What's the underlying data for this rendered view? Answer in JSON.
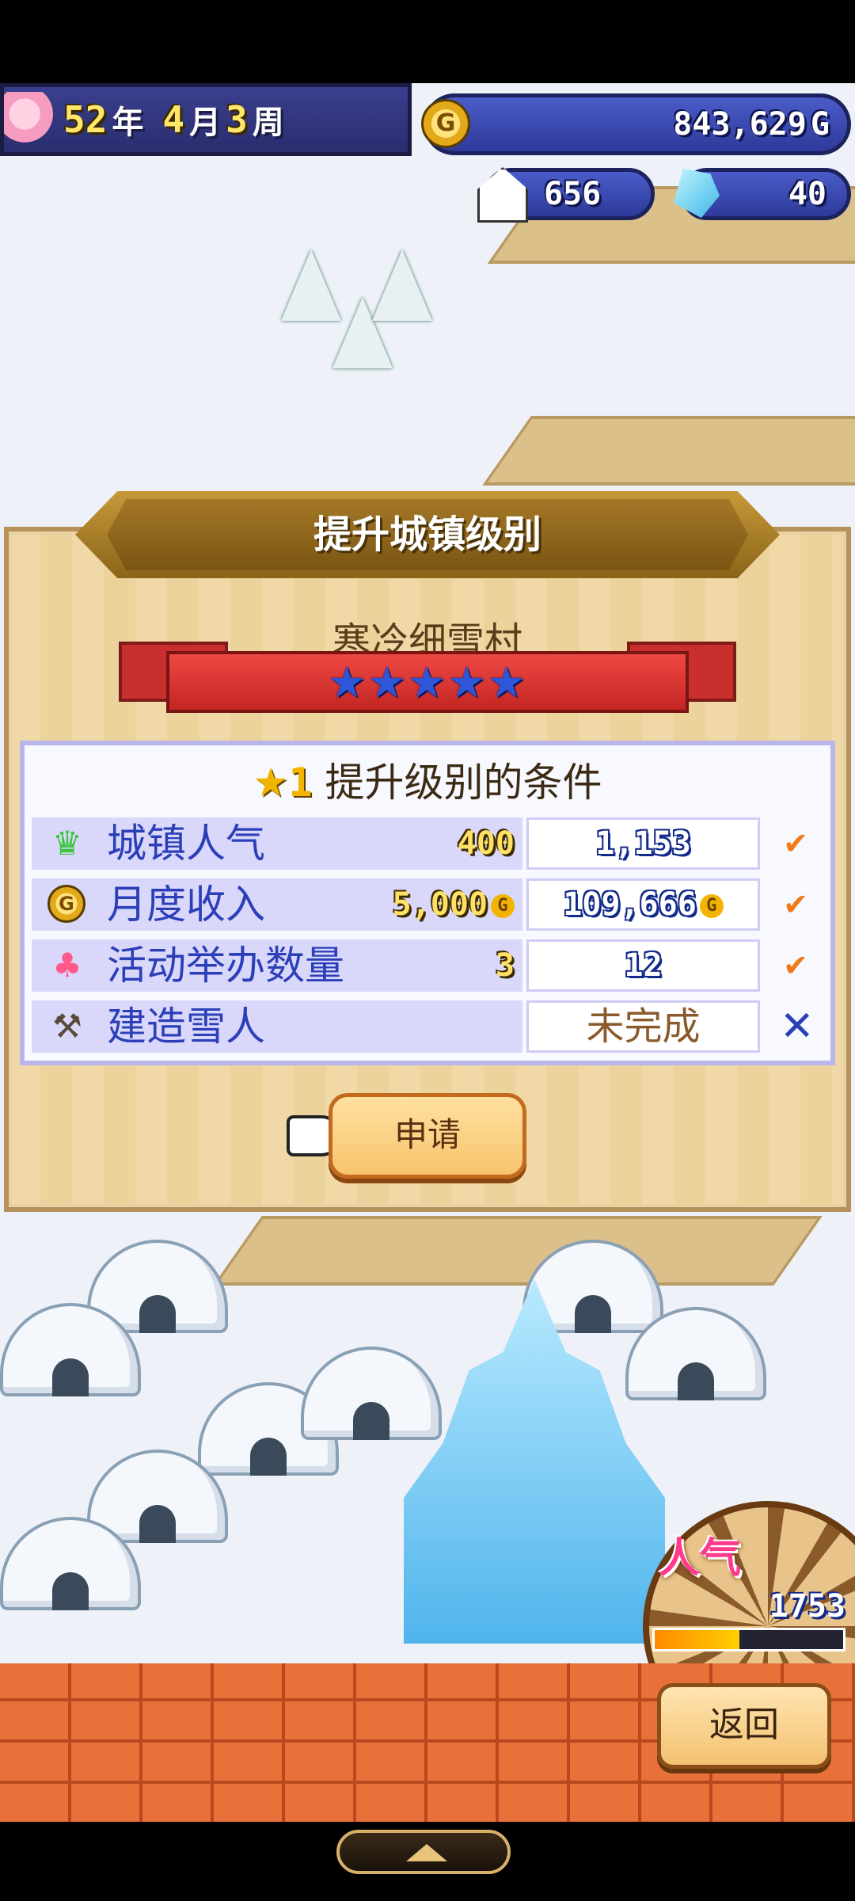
{
  "hud": {
    "year": "52",
    "year_unit": "年",
    "month": "4",
    "month_unit": "月",
    "week": "3",
    "week_unit": "周",
    "money": "843,629",
    "money_suffix": "G",
    "coin_letter": "G",
    "population": "656",
    "gems": "40"
  },
  "dialog": {
    "title": "提升城镇级别",
    "town_name": "寒冷细雪村",
    "stars": "★★★★★",
    "conditions_header": {
      "star": "★",
      "level": "1",
      "text": "提升级别的条件"
    },
    "conditions": [
      {
        "icon": "popularity-icon",
        "label": "城镇人气",
        "required": "400",
        "current": "1,153",
        "status": "✔"
      },
      {
        "icon": "coin-icon",
        "label": "月度收入",
        "required": "5,000",
        "required_suffix": "G",
        "current": "109,666",
        "current_suffix": "G",
        "status": "✔"
      },
      {
        "icon": "balloons-icon",
        "label": "活动举办数量",
        "required": "3",
        "current": "12",
        "status": "✔"
      },
      {
        "icon": "hammer-icon",
        "label": "建造雪人",
        "required": "",
        "current": "未完成",
        "status": "✕"
      }
    ],
    "apply_label": "申请"
  },
  "popularity_meter": {
    "label": "人气",
    "value": "1753",
    "fill_fraction": 0.45
  },
  "back_label": "返回",
  "colors": {
    "hud_blue": "#2e3a9a",
    "gold": "#f2b400",
    "check_orange": "#f07a1a",
    "label_blue": "#2c3fb8",
    "ribbon_red": "#c42623"
  }
}
